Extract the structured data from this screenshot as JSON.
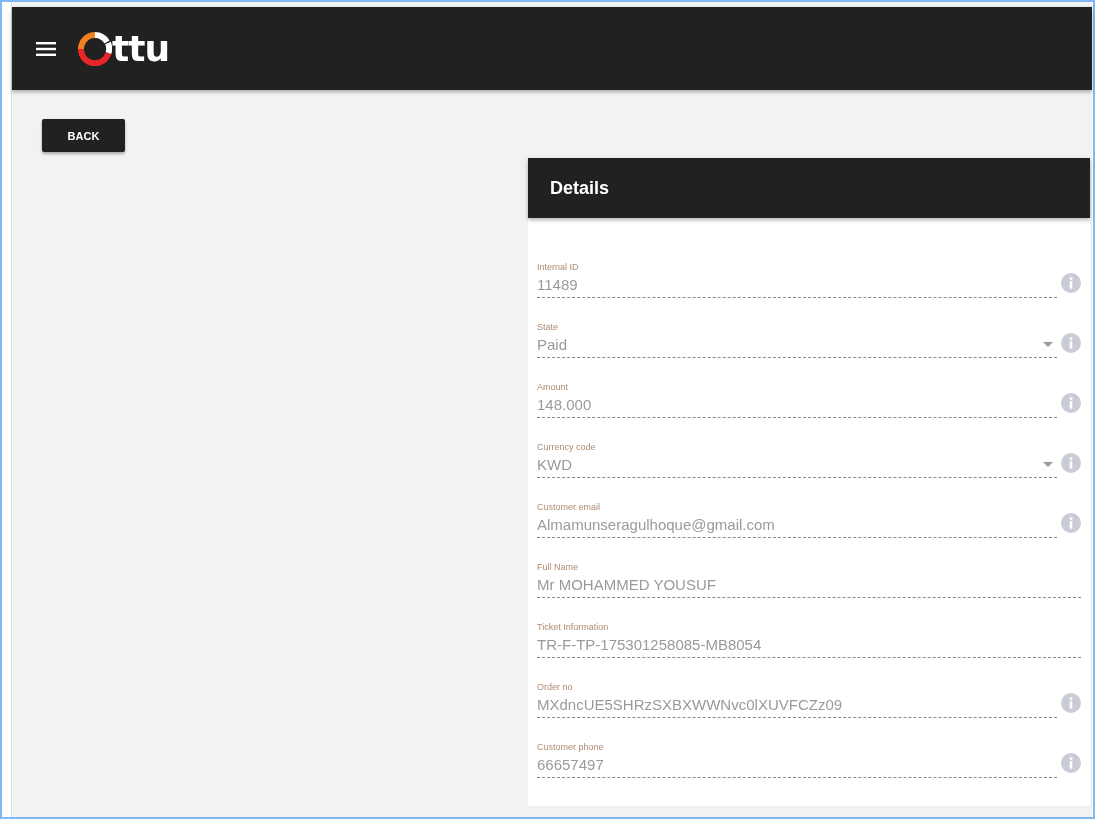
{
  "header": {
    "logo_text": "ttu"
  },
  "back_button": {
    "label": "BACK"
  },
  "details": {
    "title": "Details",
    "fields": [
      {
        "label": "Internal ID",
        "value": "11489",
        "kind": "text",
        "info": true
      },
      {
        "label": "State",
        "value": "Paid",
        "kind": "select",
        "info": true
      },
      {
        "label": "Amount",
        "value": "148.000",
        "kind": "text",
        "info": true
      },
      {
        "label": "Currency code",
        "value": "KWD",
        "kind": "select",
        "info": true
      },
      {
        "label": "Customer email",
        "value": "Almamunseragulhoque@gmail.com",
        "kind": "text",
        "info": true
      },
      {
        "label": "Full Name",
        "value": "Mr MOHAMMED YOUSUF",
        "kind": "text",
        "info": false
      },
      {
        "label": "Ticket Information",
        "value": "TR-F-TP-175301258085-MB8054",
        "kind": "text",
        "info": false
      },
      {
        "label": "Order no",
        "value": "MXdncUE5SHRzSXBXWWNvc0lXUVFCZz09",
        "kind": "text",
        "info": true
      },
      {
        "label": "Customer phone",
        "value": "66657497",
        "kind": "text",
        "info": true
      }
    ]
  }
}
